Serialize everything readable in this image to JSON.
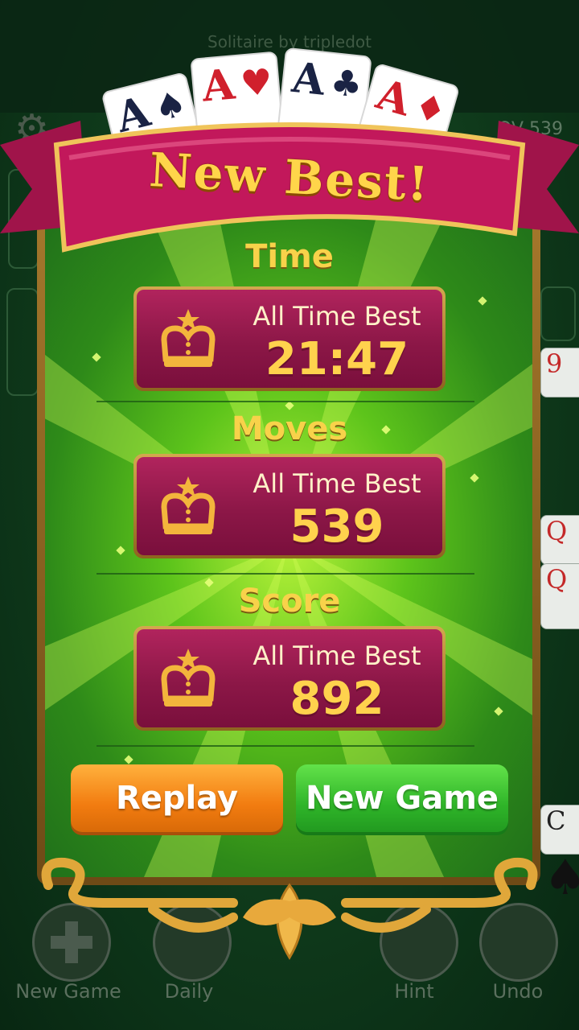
{
  "background": {
    "brand": "Solitaire by tripledot",
    "moves_partial": "OV  539",
    "card_ranks": [
      "9",
      "Q",
      "Q",
      "C"
    ],
    "bottom_bar": {
      "new_game_label": "New Game",
      "daily_label": "Daily",
      "hint_label": "Hint",
      "undo_label": "Undo"
    }
  },
  "header": {
    "cards": [
      {
        "rank": "A",
        "suit": "♠",
        "color": "#1a2344"
      },
      {
        "rank": "A",
        "suit": "♥",
        "color": "#d0202c"
      },
      {
        "rank": "A",
        "suit": "♣",
        "color": "#1a2344"
      },
      {
        "rank": "A",
        "suit": "♦",
        "color": "#d0202c"
      }
    ],
    "title": "New Best!"
  },
  "sections": [
    {
      "title": "Time",
      "label": "All Time Best",
      "value": "21:47"
    },
    {
      "title": "Moves",
      "label": "All Time Best",
      "value": "539"
    },
    {
      "title": "Score",
      "label": "All Time Best",
      "value": "892"
    }
  ],
  "buttons": {
    "replay": "Replay",
    "new_game": "New Game"
  },
  "colors": {
    "ribbon": "#c2185b",
    "panel_green": "#2e8a19",
    "gold": "#ffd24d",
    "replay_orange": "#f27c10",
    "new_game_green": "#2fb529"
  },
  "icons": [
    "gear-icon",
    "crown-icon",
    "plus-icon",
    "calendar-icon",
    "lightbulb-icon",
    "undo-icon"
  ]
}
